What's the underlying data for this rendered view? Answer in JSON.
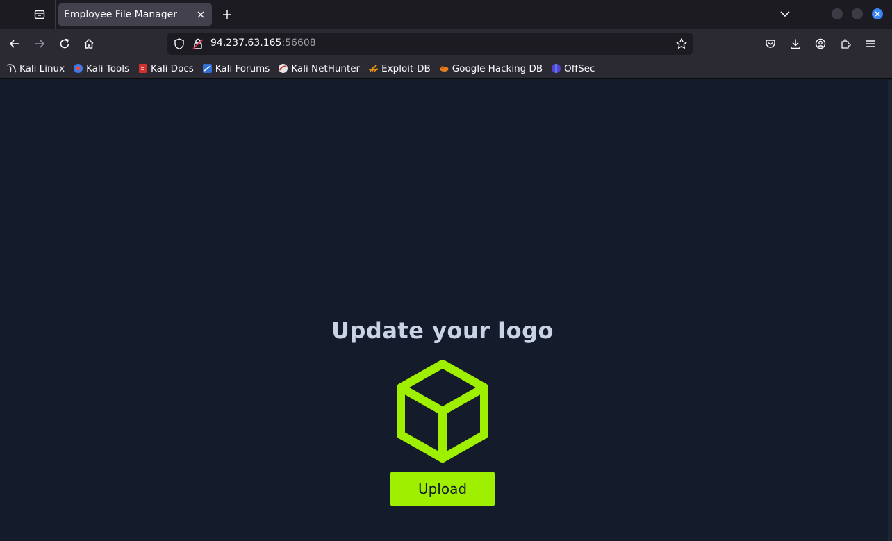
{
  "browser": {
    "tab": {
      "title": "Employee File Manager"
    },
    "url": {
      "host": "94.237.63.165",
      "port": ":56608"
    },
    "bookmarks": [
      {
        "label": "Kali Linux",
        "icon": "kali-dragon-icon"
      },
      {
        "label": "Kali Tools",
        "icon": "kali-tools-icon"
      },
      {
        "label": "Kali Docs",
        "icon": "kali-docs-icon"
      },
      {
        "label": "Kali Forums",
        "icon": "kali-forums-icon"
      },
      {
        "label": "Kali NetHunter",
        "icon": "nethunter-icon"
      },
      {
        "label": "Exploit-DB",
        "icon": "exploit-db-icon"
      },
      {
        "label": "Google Hacking DB",
        "icon": "ghdb-icon"
      },
      {
        "label": "OffSec",
        "icon": "offsec-icon"
      }
    ]
  },
  "page": {
    "headline": "Update your logo",
    "logo_icon": "cube-icon",
    "upload_label": "Upload"
  },
  "colors": {
    "accent": "#9fef00",
    "page_background": "#141b2a",
    "headline": "#c8d3e6"
  }
}
